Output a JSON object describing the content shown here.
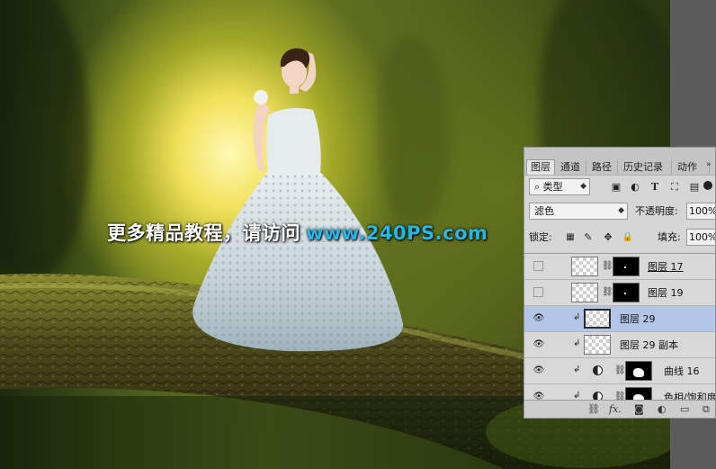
{
  "watermark": {
    "text_cn": "更多精品教程，请访问",
    "url": "www.240PS.com"
  },
  "panel": {
    "tabs": [
      "图层",
      "通道",
      "路径",
      "历史记录",
      "动作"
    ],
    "filter": {
      "icon": "search-icon",
      "value": "类型"
    },
    "blend_mode": "滤色",
    "opacity_label": "不透明度:",
    "opacity_value": "100%",
    "lock_label": "锁定:",
    "fill_label": "填充:",
    "fill_value": "100%",
    "layers": [
      {
        "name": "图层 17",
        "visible": false,
        "clipped": false,
        "selected": false
      },
      {
        "name": "图层 19",
        "visible": false,
        "clipped": false,
        "selected": false
      },
      {
        "name": "图层 29",
        "visible": true,
        "clipped": true,
        "selected": true
      },
      {
        "name": "图层 29 副本",
        "visible": true,
        "clipped": true,
        "selected": false
      },
      {
        "name": "曲线 16",
        "visible": true,
        "clipped": true,
        "selected": false
      },
      {
        "name": "色相/饱和度",
        "visible": true,
        "clipped": true,
        "selected": false
      }
    ],
    "footer_icons": [
      "link-layers-icon",
      "fx-icon",
      "add-mask-icon",
      "adjustment-icon",
      "folder-icon",
      "new-layer-icon"
    ],
    "footer_fx": "fx."
  }
}
